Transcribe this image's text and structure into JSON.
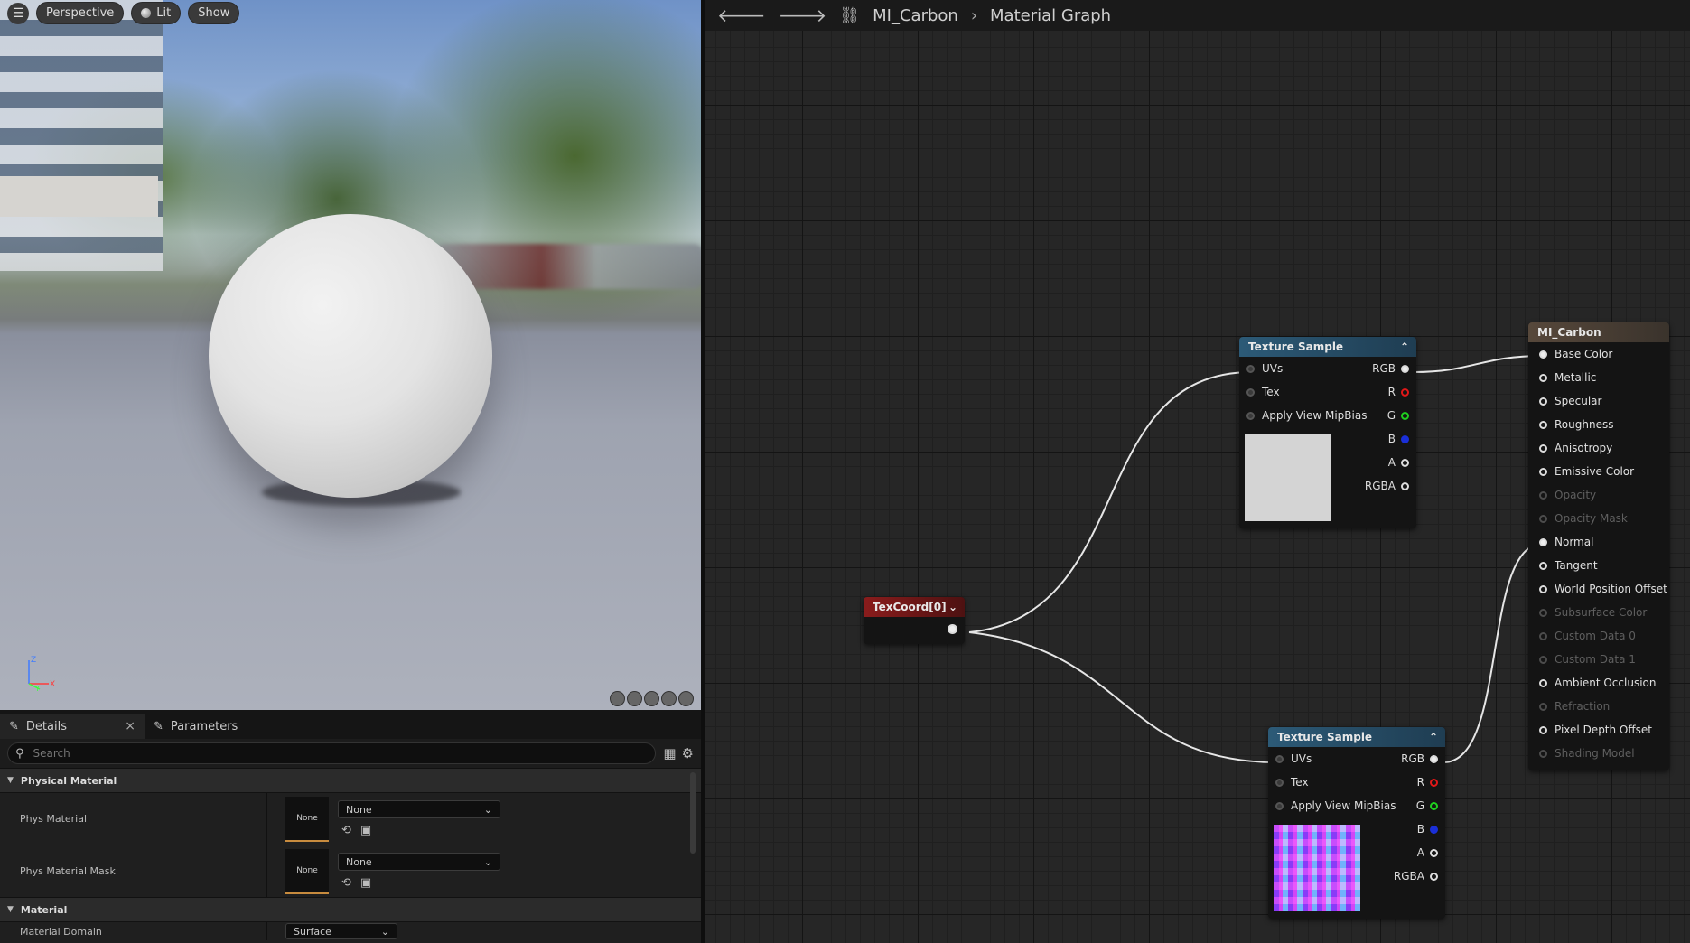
{
  "viewport": {
    "toolbar": {
      "view_mode": "Perspective",
      "lighting": "Lit",
      "show": "Show"
    },
    "axes": {
      "x": "X",
      "y": "Y",
      "z": "Z"
    }
  },
  "details_panel": {
    "tabs": [
      {
        "label": "Details"
      },
      {
        "label": "Parameters"
      }
    ],
    "search": {
      "placeholder": "Search"
    },
    "categories": [
      {
        "title": "Physical Material",
        "rows": [
          {
            "label": "Phys Material",
            "thumb": "None",
            "value": "None"
          },
          {
            "label": "Phys Material Mask",
            "thumb": "None",
            "value": "None"
          }
        ]
      },
      {
        "title": "Material",
        "rows": [
          {
            "label": "Material Domain",
            "value": "Surface"
          }
        ]
      }
    ]
  },
  "graph": {
    "breadcrumb": {
      "asset": "MI_Carbon",
      "page": "Material Graph"
    },
    "texcoord_node": {
      "title": "TexCoord[0]"
    },
    "texture_sample_top": {
      "title": "Texture Sample",
      "inputs": [
        "UVs",
        "Tex",
        "Apply View MipBias"
      ],
      "outputs": [
        "RGB",
        "R",
        "G",
        "B",
        "A",
        "RGBA"
      ]
    },
    "texture_sample_bottom": {
      "title": "Texture Sample",
      "inputs": [
        "UVs",
        "Tex",
        "Apply View MipBias"
      ],
      "outputs": [
        "RGB",
        "R",
        "G",
        "B",
        "A",
        "RGBA"
      ]
    },
    "material_node": {
      "title": "MI_Carbon",
      "inputs": [
        {
          "label": "Base Color",
          "enabled": true,
          "connected": true
        },
        {
          "label": "Metallic",
          "enabled": true,
          "connected": false
        },
        {
          "label": "Specular",
          "enabled": true,
          "connected": false
        },
        {
          "label": "Roughness",
          "enabled": true,
          "connected": false
        },
        {
          "label": "Anisotropy",
          "enabled": true,
          "connected": false
        },
        {
          "label": "Emissive Color",
          "enabled": true,
          "connected": false
        },
        {
          "label": "Opacity",
          "enabled": false,
          "connected": false
        },
        {
          "label": "Opacity Mask",
          "enabled": false,
          "connected": false
        },
        {
          "label": "Normal",
          "enabled": true,
          "connected": true
        },
        {
          "label": "Tangent",
          "enabled": true,
          "connected": false
        },
        {
          "label": "World Position Offset",
          "enabled": true,
          "connected": false
        },
        {
          "label": "Subsurface Color",
          "enabled": false,
          "connected": false
        },
        {
          "label": "Custom Data 0",
          "enabled": false,
          "connected": false
        },
        {
          "label": "Custom Data 1",
          "enabled": false,
          "connected": false
        },
        {
          "label": "Ambient Occlusion",
          "enabled": true,
          "connected": false
        },
        {
          "label": "Refraction",
          "enabled": false,
          "connected": false
        },
        {
          "label": "Pixel Depth Offset",
          "enabled": true,
          "connected": false
        },
        {
          "label": "Shading Model",
          "enabled": false,
          "connected": false
        }
      ]
    }
  }
}
